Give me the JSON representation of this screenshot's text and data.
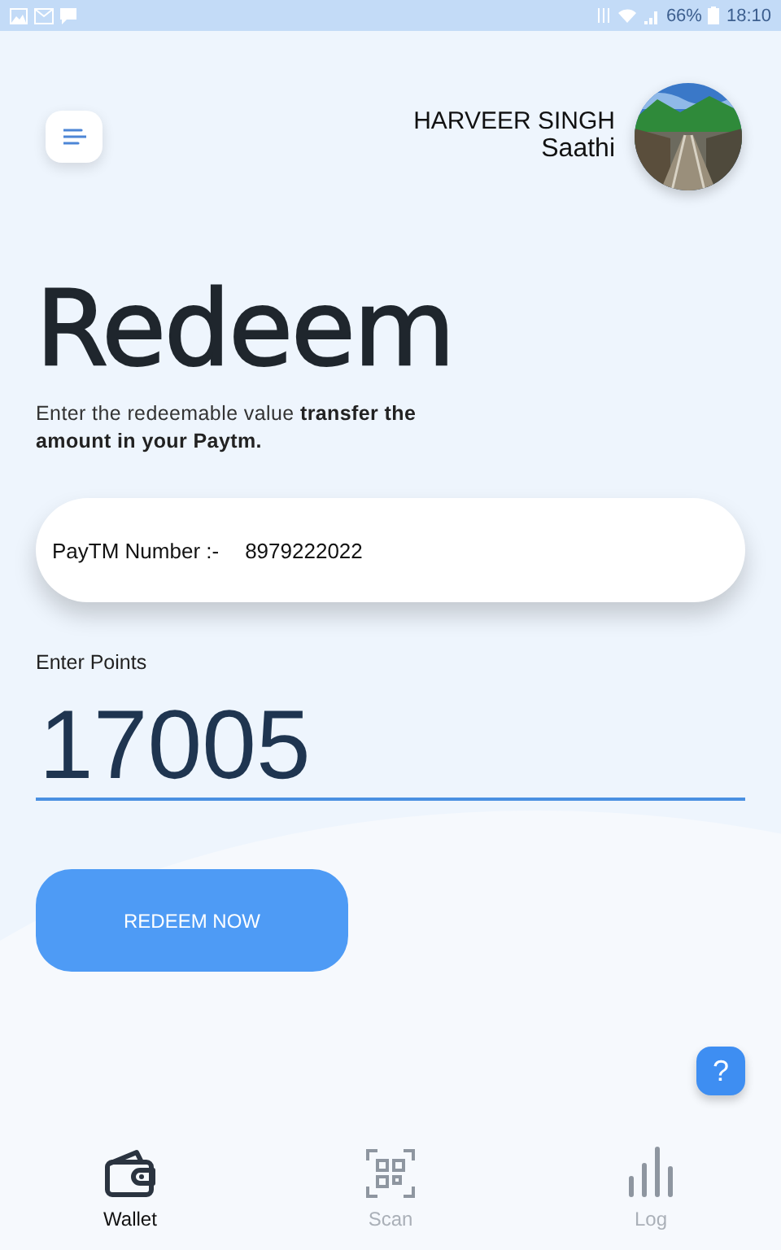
{
  "status_bar": {
    "battery": "66%",
    "time": "18:10"
  },
  "header": {
    "name": "HARVEER SINGH",
    "role": "Saathi"
  },
  "title": "Redeem",
  "description": "Enter the redeemable value **transfer the amount in your Paytm.**",
  "paytm": {
    "label": "PayTM Number :-",
    "value": "8979222022"
  },
  "points": {
    "label": "Enter Points",
    "value": "17005"
  },
  "redeem_button": "REDEEM NOW",
  "help_button": "?",
  "nav": [
    {
      "label": "Wallet",
      "kind": "wallet",
      "selected": true
    },
    {
      "label": "Scan",
      "kind": "scan",
      "selected": false
    },
    {
      "label": "Log",
      "kind": "log",
      "selected": false
    }
  ]
}
